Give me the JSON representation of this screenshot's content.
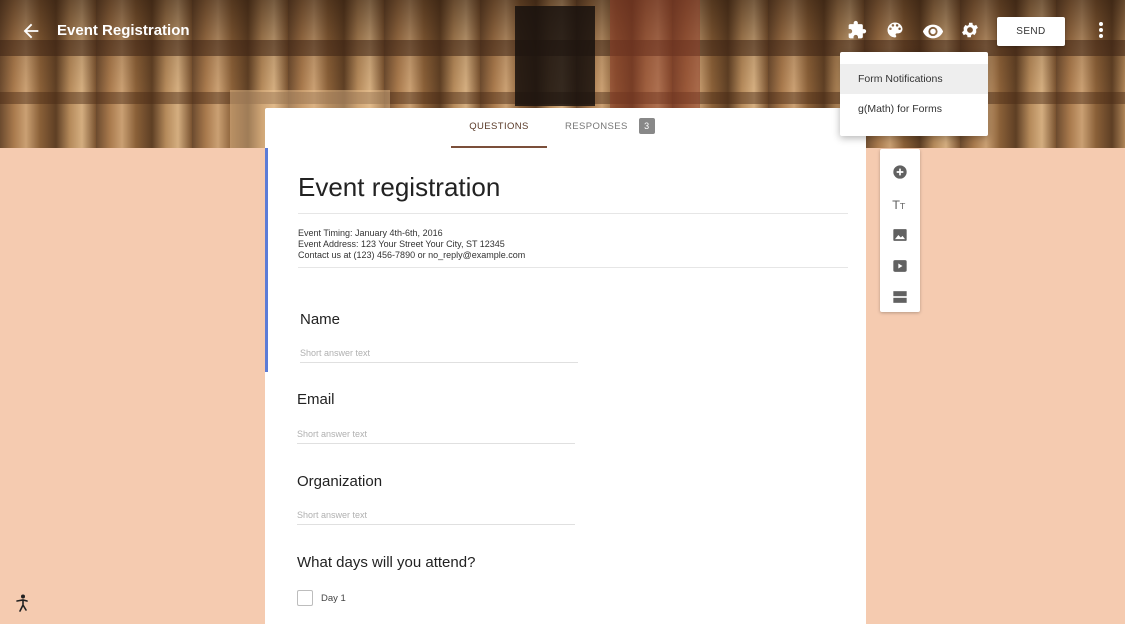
{
  "header": {
    "title": "Event Registration",
    "send_label": "SEND",
    "icons": [
      "back-arrow-icon",
      "add-on-puzzle-icon",
      "palette-icon",
      "preview-eye-icon",
      "settings-gear-icon",
      "more-vert-icon"
    ]
  },
  "addon_menu": {
    "items": [
      "Form Notifications",
      "g(Math) for Forms"
    ]
  },
  "tabs": {
    "questions_label": "QUESTIONS",
    "responses_label": "RESPONSES",
    "responses_count": "3"
  },
  "form": {
    "heading": "Event registration",
    "description": [
      "Event Timing: January 4th-6th, 2016",
      "Event Address: 123 Your Street Your City, ST 12345",
      "Contact us at (123) 456-7890 or no_reply@example.com"
    ],
    "questions": [
      {
        "title": "Name",
        "placeholder": "Short answer text"
      },
      {
        "title": "Email",
        "placeholder": "Short answer text"
      },
      {
        "title": "Organization",
        "placeholder": "Short answer text"
      },
      {
        "title": "What days will you attend?",
        "options": [
          "Day 1"
        ]
      }
    ]
  },
  "side_toolbar": {
    "icons": [
      "add-question-icon",
      "add-title-text-icon",
      "add-image-icon",
      "add-video-icon",
      "add-section-icon"
    ]
  },
  "colors": {
    "page_background": "#f5cbb0",
    "accent_bar": "#5c7cd6",
    "active_tab": "#7b4f3a"
  }
}
